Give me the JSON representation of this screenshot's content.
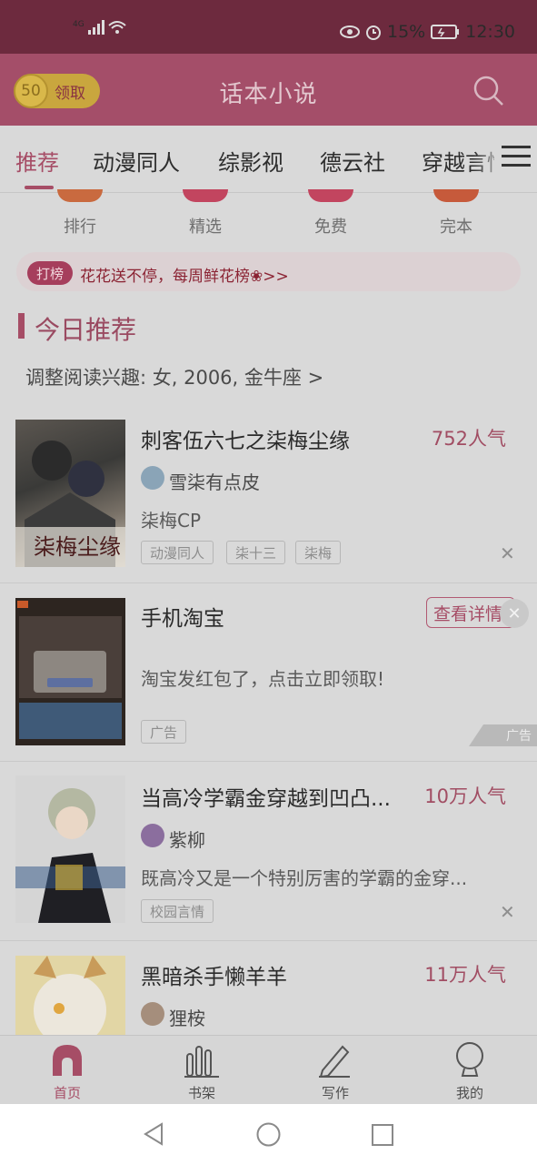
{
  "status": {
    "network": "4G",
    "battery": "15%",
    "time": "12:30"
  },
  "header": {
    "coin_count": "50",
    "claim_label": "领取",
    "title": "话本小说",
    "search_icon": "search-icon"
  },
  "tabs": [
    "推荐",
    "动漫同人",
    "综影视",
    "德云社",
    "穿越言情"
  ],
  "categories": [
    "排行",
    "精选",
    "免费",
    "完本"
  ],
  "banner": {
    "tag": "打榜",
    "text": "花花送不停，每周鲜花榜❀>>"
  },
  "section": {
    "title": "今日推荐",
    "interest": "调整阅读兴趣: 女, 2006, 金牛座 >"
  },
  "items": [
    {
      "title": "刺客伍六七之柒梅尘缘",
      "popularity": "752人气",
      "author": "雪柒有点皮",
      "desc": "柒梅CP",
      "tags": [
        "动漫同人",
        "柒十三",
        "柒梅"
      ],
      "cover_text": "柒梅尘缘"
    },
    {
      "title": "手机淘宝",
      "action": "查看详情",
      "desc": "淘宝发红包了，点击立即领取!",
      "tags": [
        "广告"
      ],
      "ad_label": "广告"
    },
    {
      "title": "当高冷学霸金穿越到凹凸...",
      "popularity": "10万人气",
      "author": "紫柳",
      "desc": "既高冷又是一个特别厉害的学霸的金穿...",
      "tags": [
        "校园言情"
      ]
    },
    {
      "title": "黑暗杀手懒羊羊",
      "popularity": "11万人气",
      "author": "狸桉"
    }
  ],
  "bottom_nav": [
    "首页",
    "书架",
    "写作",
    "我的"
  ],
  "colors": {
    "accent": "#a64d66",
    "header": "#a44e69",
    "statusbar": "#6d2a3e"
  }
}
